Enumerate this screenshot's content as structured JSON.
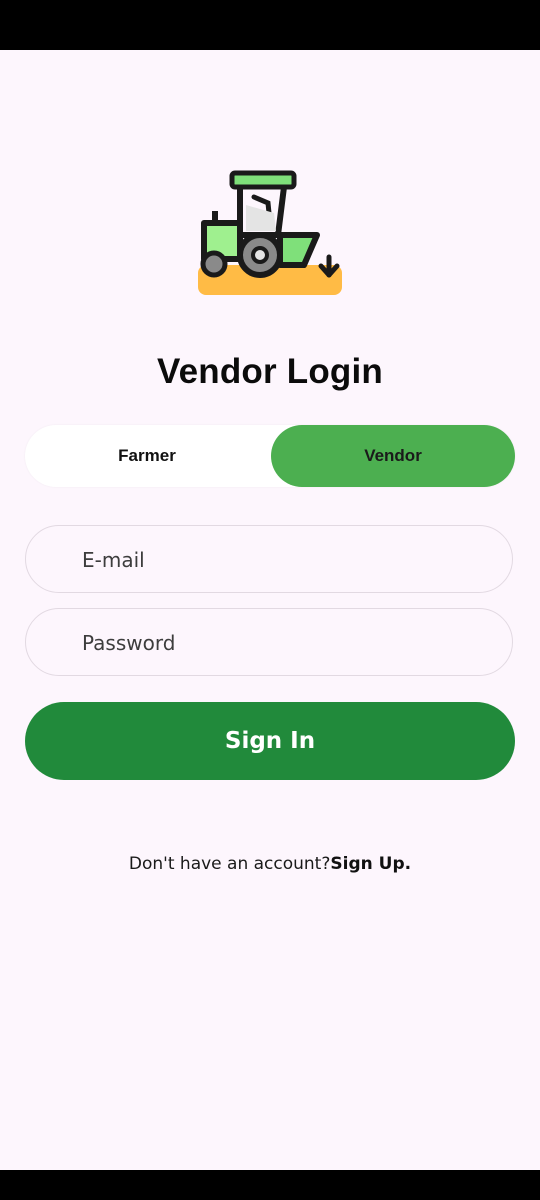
{
  "header": {
    "title": "Vendor Login"
  },
  "role_toggle": {
    "options": [
      {
        "label": "Farmer",
        "selected": false
      },
      {
        "label": "Vendor",
        "selected": true
      }
    ],
    "selected_color": "#4caf50"
  },
  "form": {
    "email": {
      "placeholder": "E-mail",
      "value": ""
    },
    "password": {
      "placeholder": "Password",
      "value": ""
    },
    "submit_label": "Sign In",
    "submit_color": "#218a3b"
  },
  "footer": {
    "prompt": "Don't have an account?",
    "signup_label": "Sign Up."
  },
  "logo": {
    "icon": "tractor-icon"
  }
}
